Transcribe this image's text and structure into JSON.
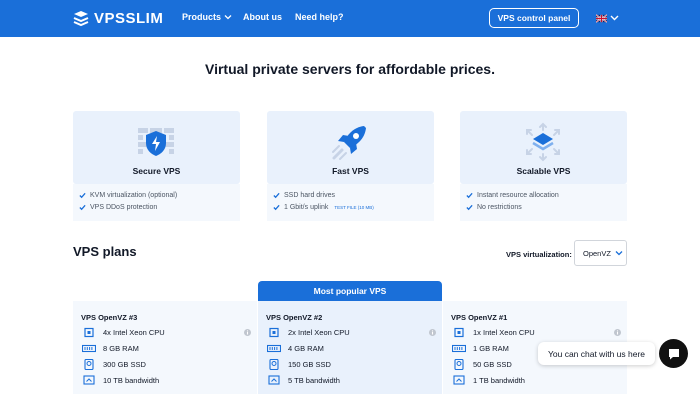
{
  "header": {
    "brand": "VPSSLIM",
    "nav": [
      {
        "label": "Products",
        "has_dropdown": true
      },
      {
        "label": "About us",
        "has_dropdown": false
      },
      {
        "label": "Need help?",
        "has_dropdown": false
      }
    ],
    "control_panel_button": "VPS control panel",
    "language_icon": "uk-flag-icon"
  },
  "headline": "Virtual private servers for affordable prices.",
  "features": [
    {
      "title": "Secure VPS",
      "icon": "shield-firewall-icon",
      "items": [
        "KVM virtualization (optional)",
        "VPS DDoS protection"
      ]
    },
    {
      "title": "Fast VPS",
      "icon": "rocket-icon",
      "items": [
        "SSD hard drives",
        "1 Gbit/s uplink"
      ],
      "test_link": "TEST FILE (10 MB)"
    },
    {
      "title": "Scalable VPS",
      "icon": "scale-arrows-icon",
      "items": [
        "Instant resource allocation",
        "No restrictions"
      ]
    }
  ],
  "plans_section": {
    "title": "VPS plans",
    "virtualization_label": "VPS virtualization:",
    "virtualization_value": "OpenVZ",
    "popular_banner": "Most popular VPS"
  },
  "plans": [
    {
      "name": "VPS OpenVZ #3",
      "cpu": "4x Intel Xeon CPU",
      "ram": "8 GB RAM",
      "disk": "300 GB SSD",
      "bandwidth": "10 TB bandwidth"
    },
    {
      "name": "VPS OpenVZ #2",
      "cpu": "2x Intel Xeon CPU",
      "ram": "4 GB RAM",
      "disk": "150 GB SSD",
      "bandwidth": "5 TB bandwidth"
    },
    {
      "name": "VPS OpenVZ #1",
      "cpu": "1x Intel Xeon CPU",
      "ram": "1 GB RAM",
      "disk": "50 GB SSD",
      "bandwidth": "1 TB bandwidth"
    }
  ],
  "chat": {
    "bubble_text": "You can chat with us here"
  },
  "colors": {
    "brand_blue": "#1a6fd9",
    "card_bg": "#e9f1fc",
    "card_bg_light": "#f4f8fd"
  }
}
